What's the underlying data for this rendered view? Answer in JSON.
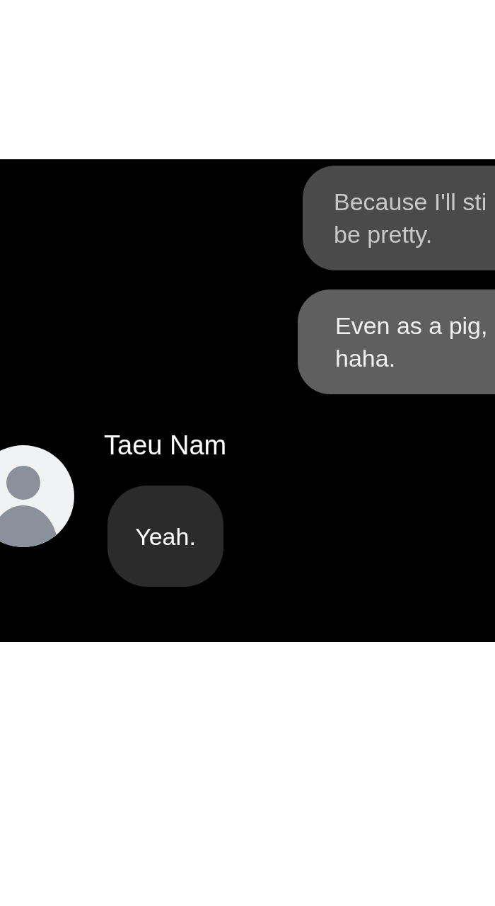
{
  "panel": {
    "messages": [
      {
        "kind": "outgoing",
        "faded": true,
        "text": "Because I'll sti\nbe pretty."
      },
      {
        "kind": "outgoing",
        "faded": false,
        "text": "Even as a pig,\nhaha."
      },
      {
        "kind": "incoming",
        "sender": "Taeu Nam",
        "text": "Yeah."
      }
    ]
  }
}
